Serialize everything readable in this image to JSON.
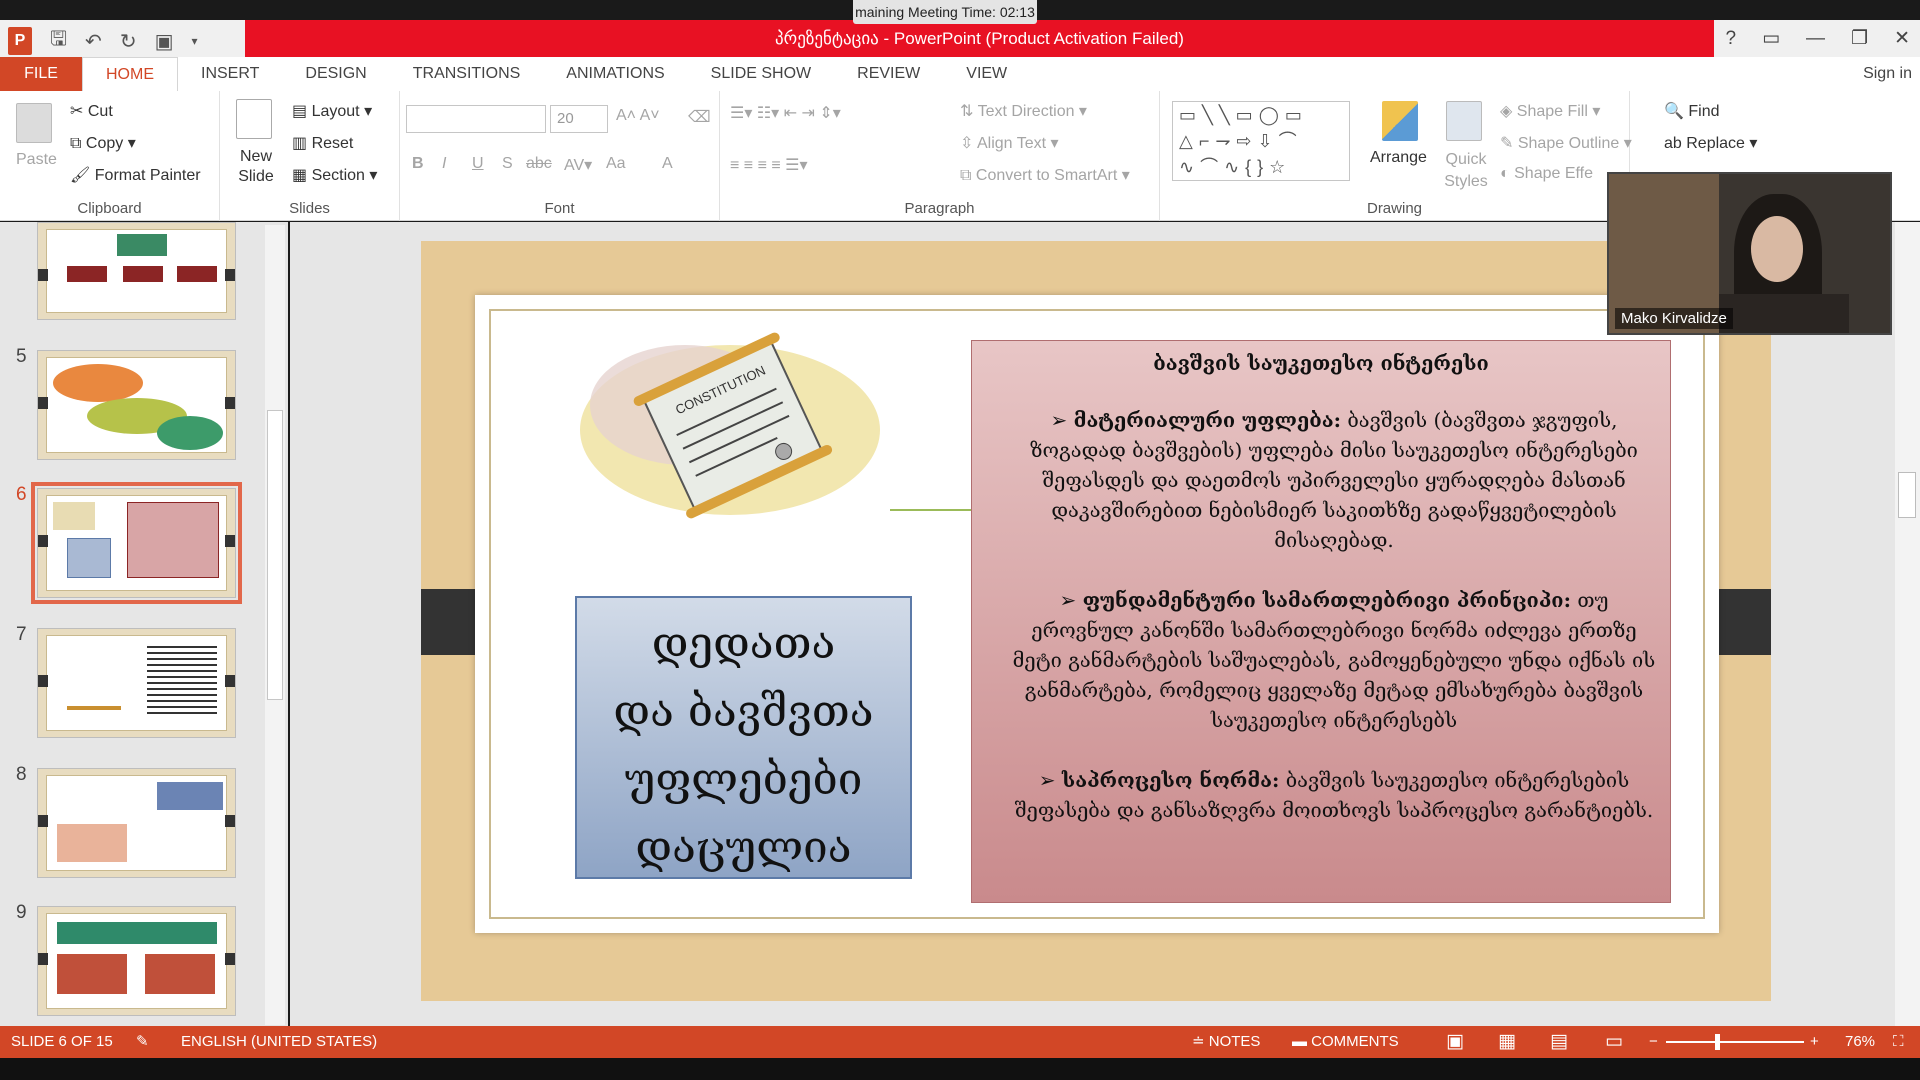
{
  "meeting": {
    "timer": "maining Meeting Time: 02:13",
    "participant_name": "Mako Kirvalidze"
  },
  "window": {
    "title": "პრეზენტაცია -  PowerPoint (Product Activation Failed)",
    "controls": [
      "?",
      "▭",
      "—",
      "❐",
      "✕"
    ]
  },
  "ribbon_tabs": [
    "FILE",
    "HOME",
    "INSERT",
    "DESIGN",
    "TRANSITIONS",
    "ANIMATIONS",
    "SLIDE SHOW",
    "REVIEW",
    "VIEW"
  ],
  "active_tab": "HOME",
  "sign_in": "Sign in",
  "clipboard": {
    "paste": "Paste",
    "cut": "Cut",
    "copy": "Copy",
    "format_painter": "Format Painter",
    "label": "Clipboard"
  },
  "slides_group": {
    "new_slide": "New Slide",
    "layout": "Layout",
    "reset": "Reset",
    "section": "Section",
    "label": "Slides"
  },
  "font_group": {
    "font_size": "20",
    "label": "Font",
    "bold": "B",
    "italic": "I",
    "underline": "U",
    "shadow": "S",
    "strike": "abc",
    "case": "Aa",
    "color": "A"
  },
  "paragraph_group": {
    "text_direction": "Text Direction",
    "align_text": "Align Text",
    "smartart": "Convert to SmartArt",
    "label": "Paragraph"
  },
  "drawing_group": {
    "arrange": "Arrange",
    "quick_styles": "Quick Styles",
    "shape_fill": "Shape Fill",
    "shape_outline": "Shape Outline",
    "shape_effects": "Shape Effe",
    "label": "Drawing"
  },
  "editing_group": {
    "find": "Find",
    "replace": "Replace"
  },
  "thumbnails": [
    {
      "number": "",
      "selected": false
    },
    {
      "number": "5",
      "selected": false
    },
    {
      "number": "6",
      "selected": true
    },
    {
      "number": "7",
      "selected": false
    },
    {
      "number": "8",
      "selected": false
    },
    {
      "number": "9",
      "selected": false
    }
  ],
  "slide": {
    "box_title": "ბავშვის საუკეთესო ინტერესი",
    "bullets": [
      {
        "term": "მატერიალური უფლება:",
        "text": "ბავშვის (ბავშვთა ჯგუფის, ზოგადად ბავშვების) უფლება მისი საუკეთესო ინტერესები შეფასდეს და დაეთმოს უპირველესი ყურადღება მასთან დაკავშირებით ნებისმიერ საკითხზე გადაწყვეტილების მისაღებად."
      },
      {
        "term": "ფუნდამენტური სამართლებრივი პრინციპი:",
        "text": "თუ ეროვნულ კანონში სამართლებრივი ნორმა იძლევა ერთზე მეტი განმარტების საშუალებას, გამოყენებული უნდა იქნას ის განმარტება, რომელიც ყველაზე მეტად ემსახურება ბავშვის საუკეთესო ინტერესებს"
      },
      {
        "term": "საპროცესო ნორმა:",
        "text": "ბავშვის საუკეთესო ინტერესების შეფასება და განსაზღვრა მოითხოვს საპროცესო გარანტიებს."
      }
    ],
    "blue_box_lines": [
      "დედათა",
      "და ბავშვთა",
      "უფლებები",
      "დაცულია"
    ],
    "scroll_text": "CONSTITUTION"
  },
  "status": {
    "slide_info": "SLIDE 6 OF 15",
    "language": "ENGLISH (UNITED STATES)",
    "notes": "NOTES",
    "comments": "COMMENTS",
    "zoom": "76%"
  }
}
